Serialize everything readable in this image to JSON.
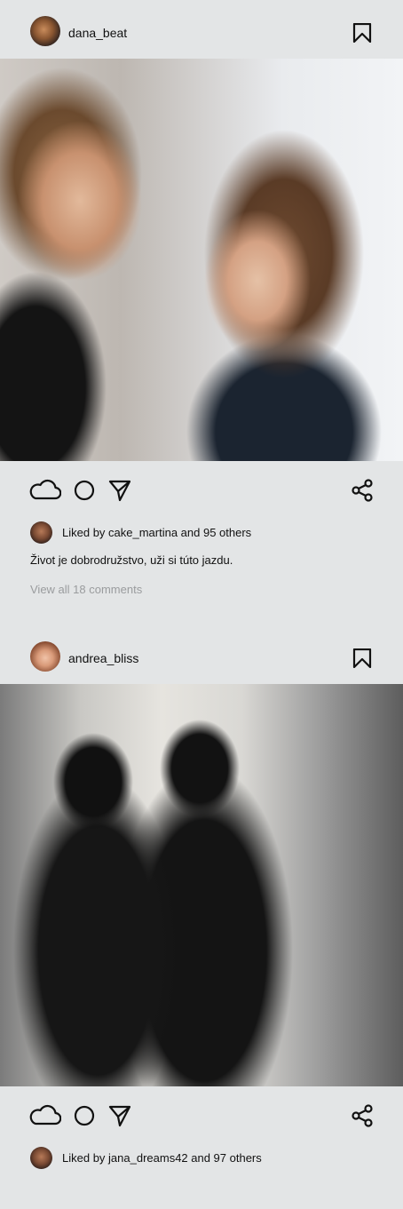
{
  "posts": [
    {
      "username": "dana_beat",
      "photo_alt": "",
      "liked_by_user": "cake_martina",
      "likes_text": "Liked by cake_martina and 95 others",
      "caption": "Život je dobrodružstvo, uži si túto jazdu.",
      "view_comments": "View all 18 comments"
    },
    {
      "username": "andrea_bliss",
      "photo_alt": "",
      "liked_by_user": "jana_dreams42",
      "likes_text": "Liked by jana_dreams42 and 97 others"
    }
  ],
  "icons": {
    "bookmark": "bookmark-icon",
    "like": "cloud-like-icon",
    "comment": "circle-comment-icon",
    "send": "send-triangle-icon",
    "share": "share-icon"
  },
  "colors": {
    "background": "#e3e5e6",
    "text": "#111111",
    "muted": "#9a9c9e"
  }
}
